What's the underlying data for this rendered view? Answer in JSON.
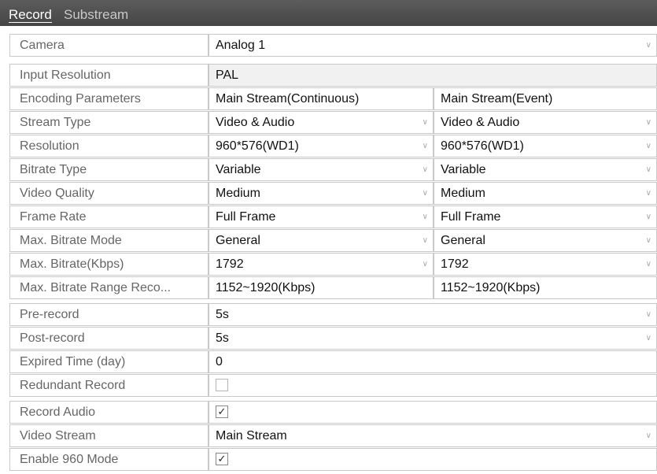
{
  "tabs": [
    {
      "label": "Record",
      "active": true
    },
    {
      "label": "Substream",
      "active": false
    }
  ],
  "rows": [
    {
      "label": "Camera",
      "type": "select",
      "value": "Analog 1"
    },
    {
      "label": "Input Resolution",
      "type": "text",
      "value": "PAL",
      "readonly": true
    },
    {
      "label": "Encoding Parameters",
      "type": "dual-header",
      "values": [
        "Main Stream(Continuous)",
        "Main Stream(Event)"
      ]
    },
    {
      "label": "Stream Type",
      "type": "dual-select",
      "values": [
        "Video & Audio",
        "Video & Audio"
      ]
    },
    {
      "label": "Resolution",
      "type": "dual-select",
      "values": [
        "960*576(WD1)",
        "960*576(WD1)"
      ]
    },
    {
      "label": "Bitrate Type",
      "type": "dual-select",
      "values": [
        "Variable",
        "Variable"
      ]
    },
    {
      "label": "Video Quality",
      "type": "dual-select",
      "values": [
        "Medium",
        "Medium"
      ]
    },
    {
      "label": "Frame Rate",
      "type": "dual-select",
      "values": [
        "Full Frame",
        "Full Frame"
      ]
    },
    {
      "label": "Max. Bitrate Mode",
      "type": "dual-select",
      "values": [
        "General",
        "General"
      ]
    },
    {
      "label": "Max. Bitrate(Kbps)",
      "type": "dual-select",
      "values": [
        "1792",
        "1792"
      ]
    },
    {
      "label": "Max. Bitrate Range Reco...",
      "type": "dual-text",
      "values": [
        "1152~1920(Kbps)",
        "1152~1920(Kbps)"
      ]
    },
    {
      "label": "Pre-record",
      "type": "select",
      "value": "5s"
    },
    {
      "label": "Post-record",
      "type": "select",
      "value": "5s"
    },
    {
      "label": "Expired Time (day)",
      "type": "text",
      "value": "0"
    },
    {
      "label": "Redundant Record",
      "type": "checkbox",
      "checked": false
    },
    {
      "label": "Record Audio",
      "type": "checkbox",
      "checked": true
    },
    {
      "label": "Video Stream",
      "type": "select",
      "value": "Main Stream"
    },
    {
      "label": "Enable 960 Mode",
      "type": "checkbox",
      "checked": true
    }
  ],
  "icons": {
    "dropdown": "chevron-down-icon",
    "check": "check-icon"
  }
}
